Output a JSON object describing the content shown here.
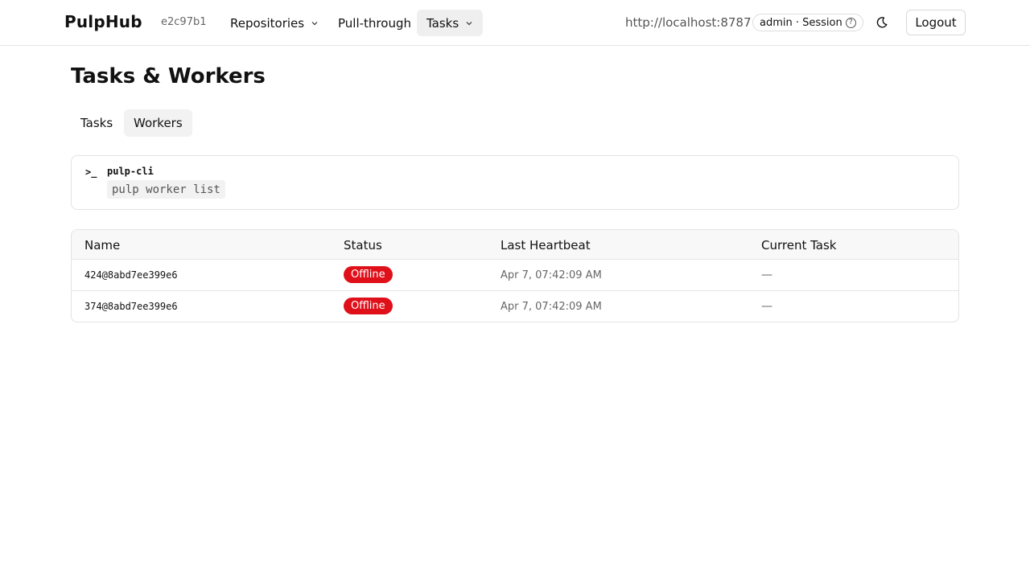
{
  "header": {
    "brand": "PulpHub",
    "commit": "e2c97b1",
    "nav": [
      {
        "label": "Repositories",
        "has_dropdown": true
      },
      {
        "label": "Pull-through",
        "has_dropdown": false
      },
      {
        "label": "Tasks",
        "has_dropdown": true,
        "active": true
      }
    ],
    "host": "http://localhost:8787",
    "session": "admin · Session",
    "help_icon": "question-circle-icon",
    "theme_icon": "moon-icon",
    "logout_label": "Logout"
  },
  "page": {
    "title": "Tasks & Workers",
    "tabs": [
      {
        "label": "Tasks",
        "active": false
      },
      {
        "label": "Workers",
        "active": true
      }
    ]
  },
  "cli": {
    "icon": ">_",
    "tool": "pulp-cli",
    "command": "pulp worker list"
  },
  "table": {
    "columns": [
      "Name",
      "Status",
      "Last Heartbeat",
      "Current Task"
    ],
    "rows": [
      {
        "name": "424@8abd7ee399e6",
        "status": "Offline",
        "last_heartbeat": "Apr 7, 07:42:09 AM",
        "current_task": "—"
      },
      {
        "name": "374@8abd7ee399e6",
        "status": "Offline",
        "last_heartbeat": "Apr 7, 07:42:09 AM",
        "current_task": "—"
      }
    ]
  },
  "colors": {
    "offline_badge": "#e0101a",
    "active_bg": "#efefef"
  }
}
